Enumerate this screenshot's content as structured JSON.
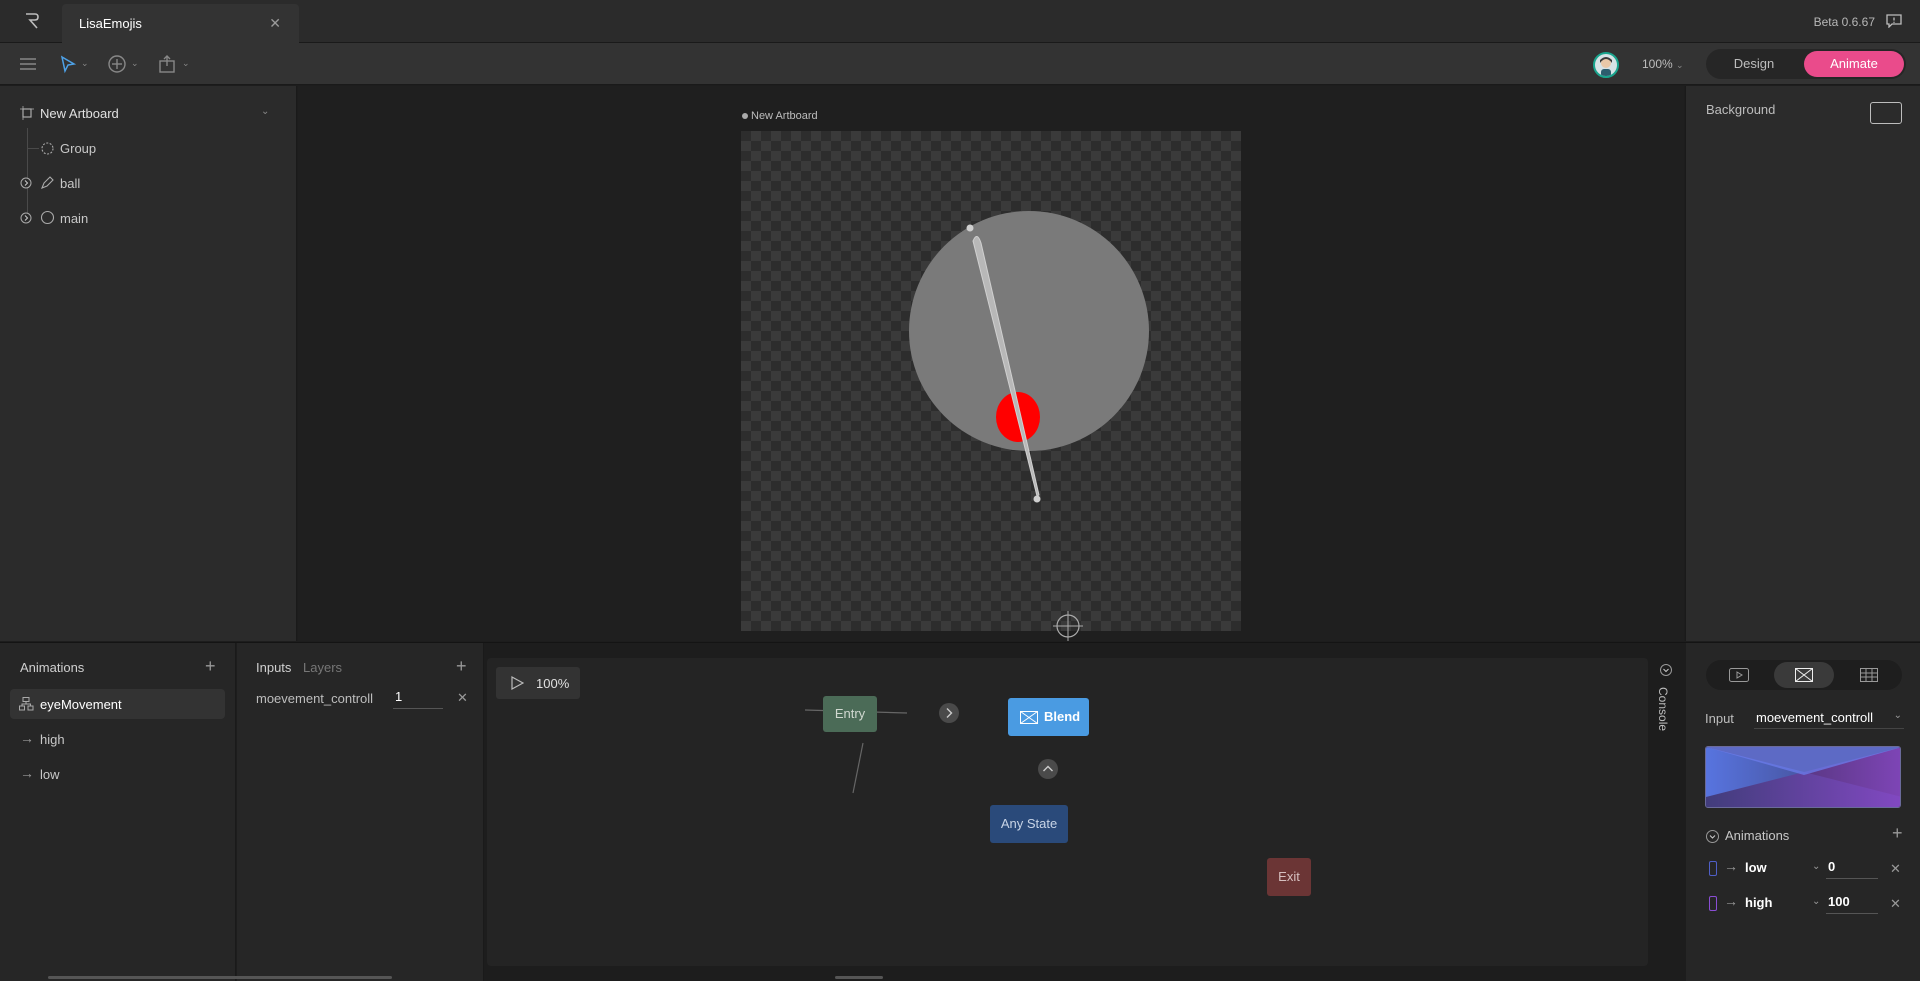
{
  "tabbar": {
    "document_tab": "LisaEmojis",
    "version": "Beta 0.6.67"
  },
  "toolbar": {
    "zoom": "100%",
    "design_label": "Design",
    "animate_label": "Animate",
    "accent_color": "#ea4b8b"
  },
  "hierarchy": {
    "artboard": "New Artboard",
    "items": [
      {
        "label": "Group",
        "icon": "group-icon"
      },
      {
        "label": "ball",
        "icon": "pen-icon"
      },
      {
        "label": "main",
        "icon": "ellipse-icon"
      }
    ]
  },
  "canvas": {
    "artboard_label": "New Artboard"
  },
  "inspector": {
    "background_label": "Background"
  },
  "animations": {
    "title": "Animations",
    "items": [
      {
        "label": "eyeMovement",
        "icon": "state-machine-icon",
        "selected": true
      },
      {
        "label": "high",
        "icon": "arrow-right-icon"
      },
      {
        "label": "low",
        "icon": "arrow-right-icon"
      }
    ]
  },
  "inputs": {
    "tab_inputs": "Inputs",
    "tab_layers": "Layers",
    "name": "moevement_controll",
    "value": "1"
  },
  "graph": {
    "play_zoom": "100%",
    "entry": "Entry",
    "blend": "Blend",
    "any_state": "Any State",
    "exit": "Exit",
    "console_label": "Console"
  },
  "blend_state": {
    "input_label": "Input",
    "input_value": "moevement_controll",
    "animations_label": "Animations",
    "rows": [
      {
        "name": "low",
        "value": "0",
        "color": "#4f5fc7"
      },
      {
        "name": "high",
        "value": "100",
        "color": "#8a4ed4"
      }
    ]
  }
}
